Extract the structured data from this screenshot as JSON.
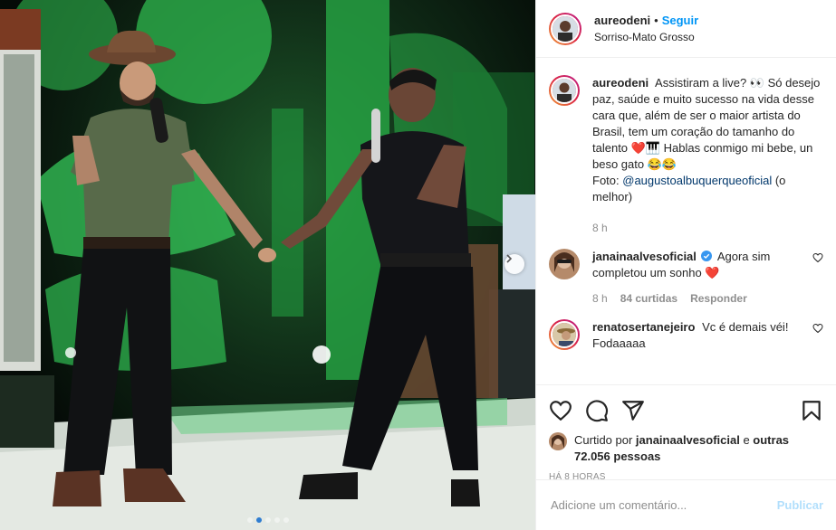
{
  "post": {
    "photo_alt": "Dois homens de mãos dadas no palco",
    "carousel_dots": 5,
    "carousel_active": 1
  },
  "header": {
    "username": "aureodeni",
    "follow_label": "Seguir",
    "separator": "•",
    "location": "Sorriso-Mato Grosso"
  },
  "caption": {
    "username": "aureodeni",
    "text_1": "Assistiram a live? 👀 Só desejo paz, saúde e muito sucesso na vida desse cara que, além de ser o maior artista do Brasil, tem um coração do tamanho do talento ❤️🎹 Hablas conmigo mi bebe, un beso gato 😂😂",
    "text_2_prefix": "Foto: ",
    "mention": "@augustoalbuquerqueoficial",
    "text_2_suffix": " (o melhor)",
    "time": "8 h"
  },
  "comments": [
    {
      "username": "janainaalvesoficial",
      "verified": true,
      "text": "Agora sim completou um sonho ❤️",
      "time": "8 h",
      "likes": "84 curtidas",
      "reply": "Responder"
    },
    {
      "username": "renatosertanejeiro",
      "verified": false,
      "text": "Vc é demais véi! Fodaaaaa"
    }
  ],
  "likes": {
    "prefix": "Curtido por ",
    "by": "janainaalvesoficial",
    "middle": " e ",
    "others": "outras 72.056 pessoas"
  },
  "timestamp": "HÁ 8 HORAS",
  "add_comment": {
    "placeholder": "Adicione um comentário...",
    "publish_label": "Publicar"
  },
  "colors": {
    "accent": "#0095f6",
    "publish_disabled": "#b2dffc",
    "heart": "#ed4956",
    "verified": "#3897f0"
  }
}
